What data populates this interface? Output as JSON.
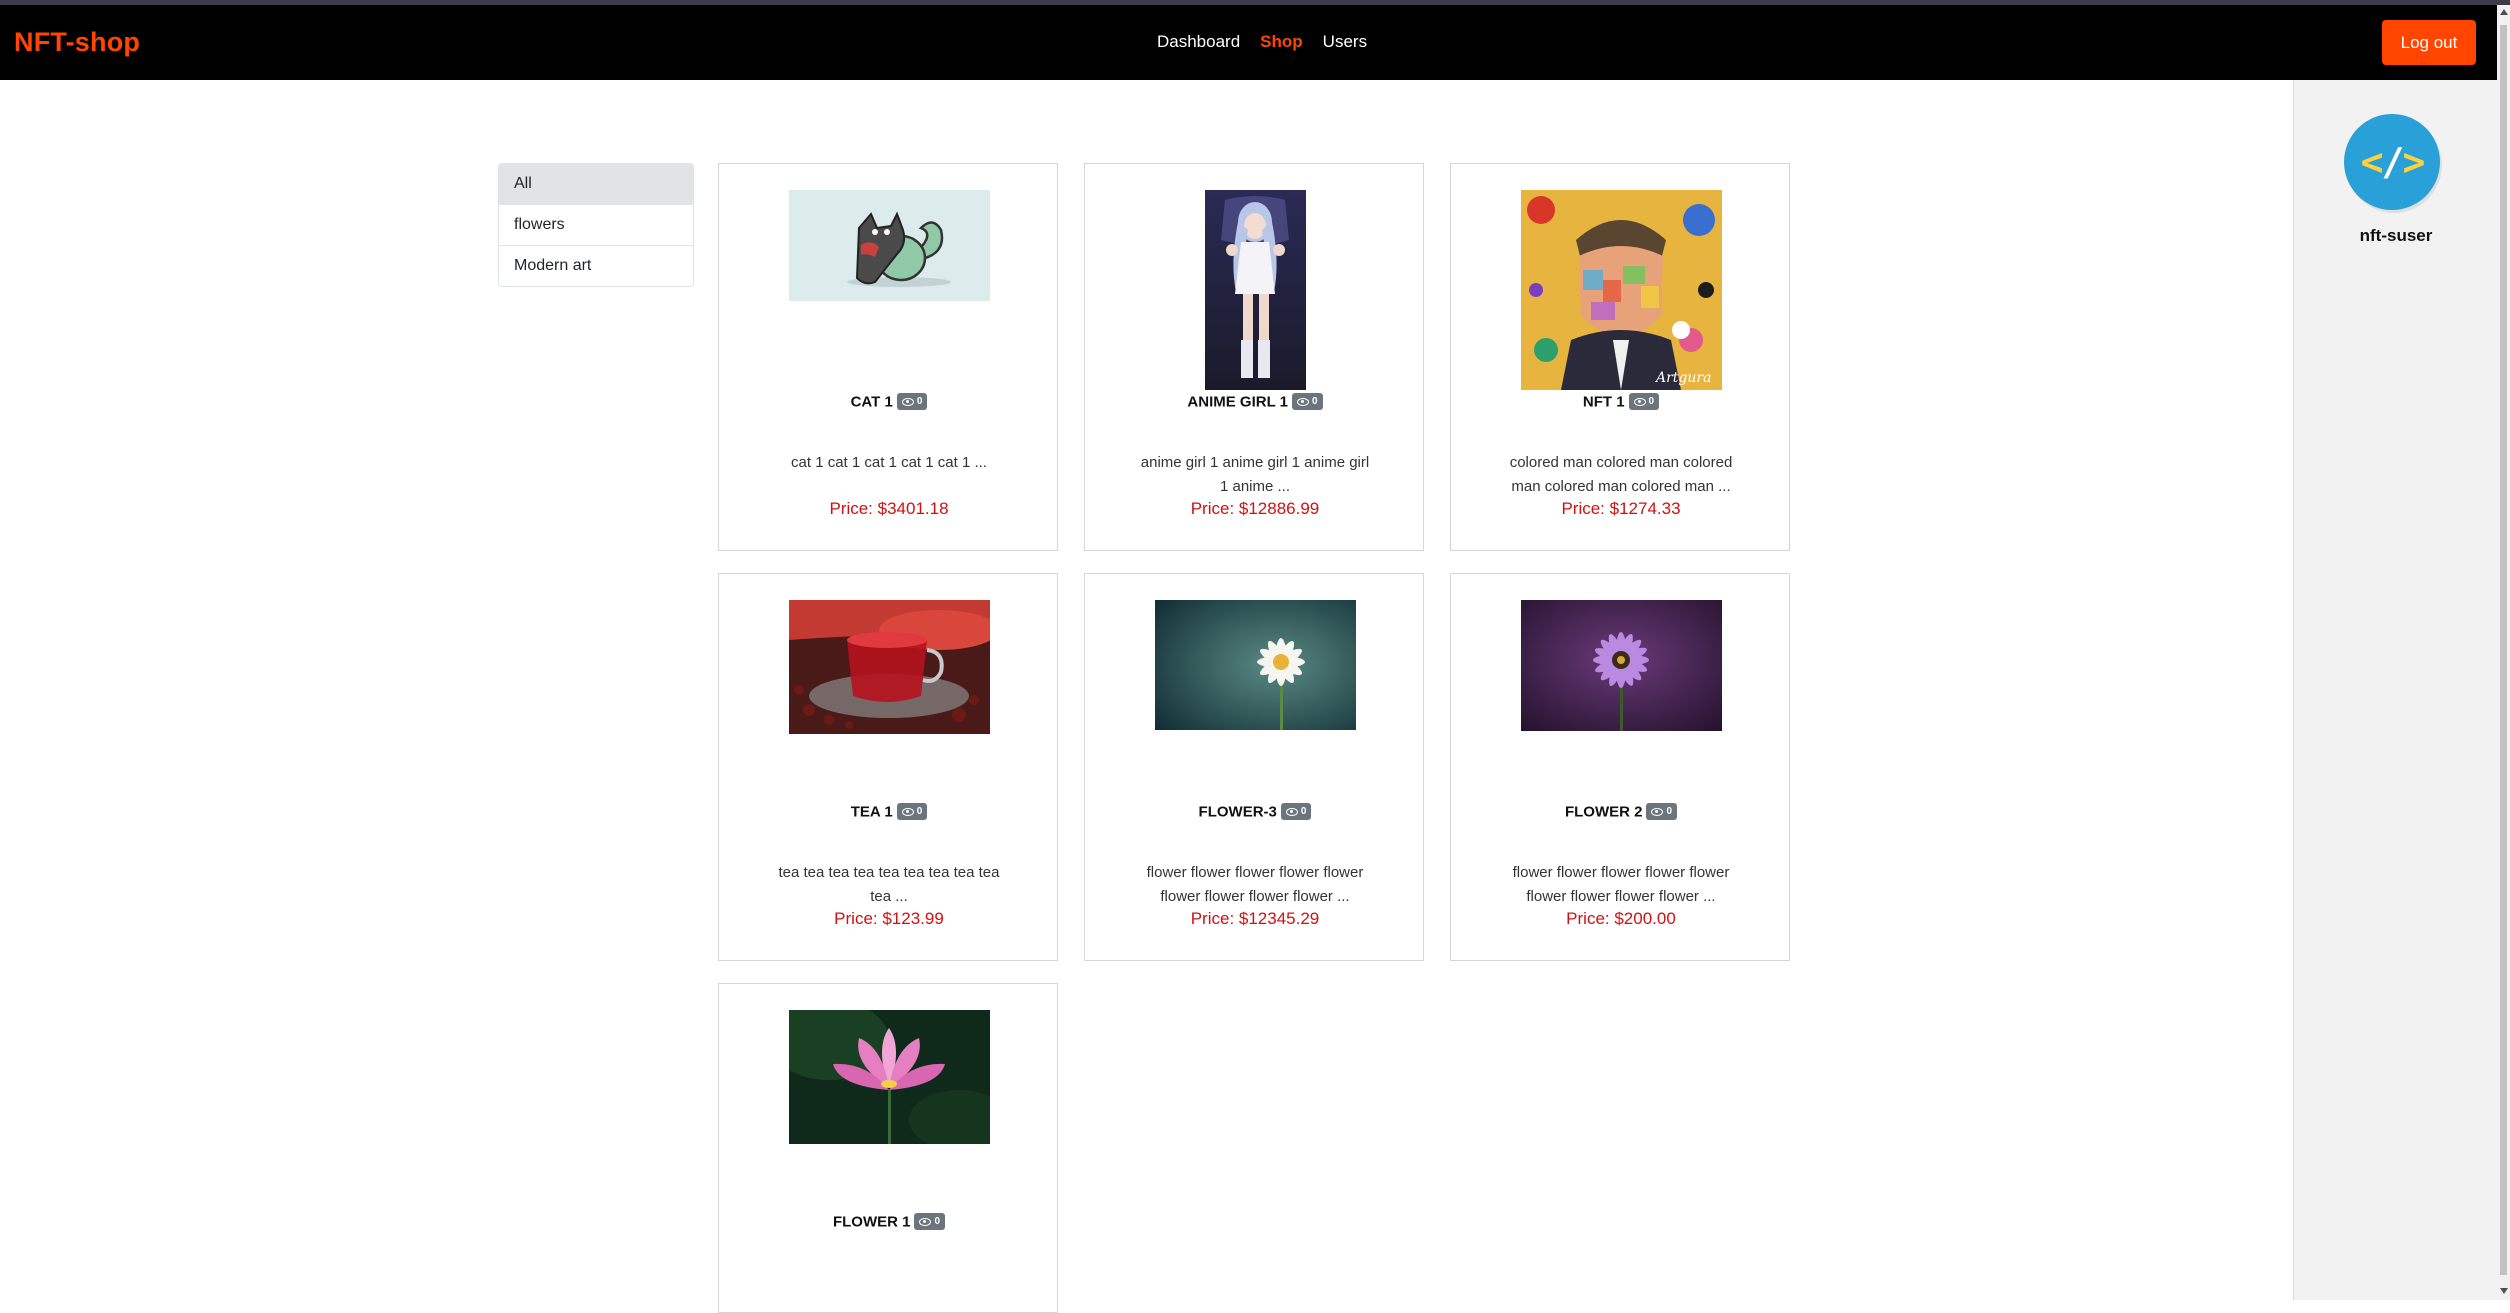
{
  "navbar": {
    "brand": "NFT-shop",
    "links": [
      "Dashboard",
      "Shop",
      "Users"
    ],
    "logout_label": "Log out"
  },
  "user": {
    "name": "nft-suser",
    "avatar_icon": "code-icon"
  },
  "categories": [
    "All",
    "flowers",
    "Modern art"
  ],
  "products": [
    {
      "title": "CAT 1",
      "views": "0",
      "description": "cat 1 cat 1 cat 1 cat 1 cat 1 ...",
      "price": "Price: $3401.18"
    },
    {
      "title": "ANIME GIRL 1",
      "views": "0",
      "description": "anime girl 1 anime girl 1 anime girl 1 anime ...",
      "price": "Price: $12886.99"
    },
    {
      "title": "NFT 1",
      "views": "0",
      "description": "colored man colored man colored man colored man colored man ...",
      "price": "Price: $1274.33"
    },
    {
      "title": "TEA 1",
      "views": "0",
      "description": "tea tea tea tea tea tea tea tea tea tea ...",
      "price": "Price: $123.99"
    },
    {
      "title": "FLOWER-3",
      "views": "0",
      "description": "flower flower flower flower flower flower flower flower flower ...",
      "price": "Price: $12345.29"
    },
    {
      "title": "FLOWER 2",
      "views": "0",
      "description": "flower flower flower flower flower flower flower flower flower ...",
      "price": "Price: $200.00"
    },
    {
      "title": "FLOWER 1",
      "views": "0",
      "description": "",
      "price": ""
    }
  ],
  "colors": {
    "accent": "#ff4500",
    "price": "#d21010",
    "navbar": "#000000",
    "badge": "#6c757d"
  }
}
